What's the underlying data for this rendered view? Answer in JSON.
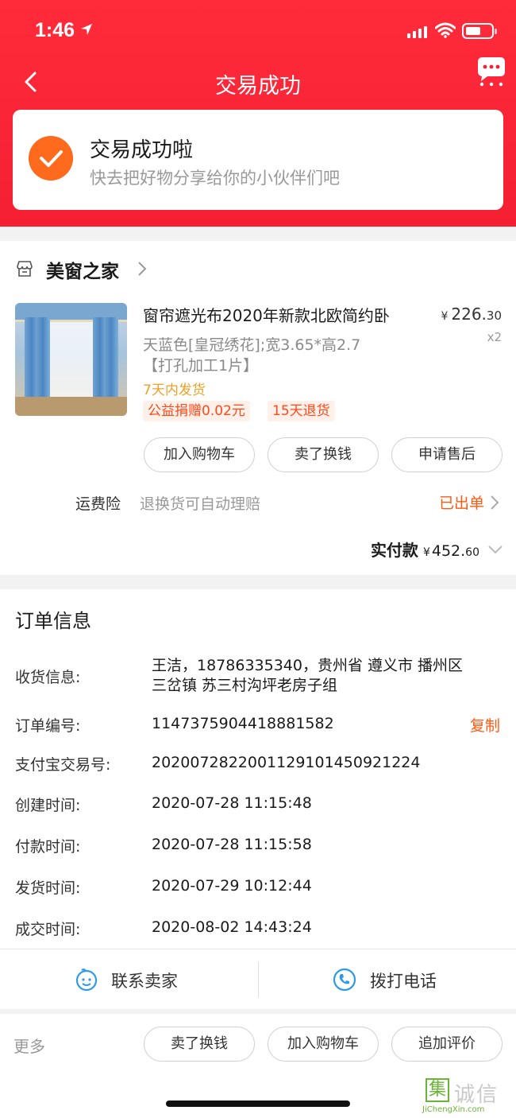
{
  "status_bar": {
    "time": "1:46"
  },
  "nav": {
    "title": "交易成功"
  },
  "success": {
    "title": "交易成功啦",
    "subtitle": "快去把好物分享给你的小伙伴们吧"
  },
  "shop": {
    "name": "美窗之家"
  },
  "item": {
    "title": "窗帘遮光布2020年新款北欧简约卧",
    "sku_line1": "天蓝色[皇冠绣花];宽3.65*高2.7",
    "sku_line2": "【打孔加工1片】",
    "shipping": "7天内发货",
    "tags": [
      "公益捐赠0.02元",
      "15天退货"
    ],
    "price_currency": "¥",
    "price_int": "226.",
    "price_dec": "30",
    "quantity": "x2"
  },
  "item_actions": [
    "加入购物车",
    "卖了换钱",
    "申请售后"
  ],
  "insurance": {
    "label": "运费险",
    "desc": "退换货可自动理赔",
    "status": "已出单"
  },
  "payment": {
    "label": "实付款",
    "currency": "¥",
    "amount_int": "452.",
    "amount_dec": "60"
  },
  "order": {
    "heading": "订单信息",
    "address_label": "收货信息:",
    "address_line1": "王洁，18786335340，贵州省 遵义市 播州区",
    "address_line2": "三岔镇 苏三村沟坪老房子组",
    "order_no_label": "订单编号:",
    "order_no": "1147375904418881582",
    "copy_label": "复制",
    "alipay_label": "支付宝交易号:",
    "alipay_no": "2020072822001129101450921224",
    "created_label": "创建时间:",
    "created": "2020-07-28 11:15:48",
    "paid_label": "付款时间:",
    "paid": "2020-07-28 11:15:58",
    "shipped_label": "发货时间:",
    "shipped": "2020-07-29 10:12:44",
    "closed_label": "成交时间:",
    "closed": "2020-08-02 14:43:24"
  },
  "contact": {
    "seller": "联系卖家",
    "phone": "拨打电话"
  },
  "more": {
    "label": "更多",
    "actions": [
      "卖了换钱",
      "加入购物车",
      "追加评价"
    ]
  },
  "watermark": {
    "mark": "集",
    "text": "诚信",
    "domain": "JiChengXin.com"
  },
  "colors": {
    "brand_red": "#f51f33",
    "accent_orange": "#ff5a12",
    "ship_orange": "#f2a024"
  }
}
